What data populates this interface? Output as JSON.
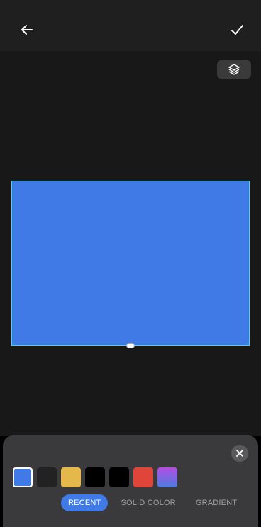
{
  "toolbar": {
    "back_icon": "arrow-left-icon",
    "confirm_icon": "checkmark-icon"
  },
  "canvas": {
    "layers_icon": "layers-icon",
    "selected_fill_color": "#3f7ae6",
    "frame_border_color": "#47d6e6"
  },
  "color_panel": {
    "close_icon": "close-icon",
    "swatches": [
      {
        "color": "#3f7ae6",
        "selected": true
      },
      {
        "color": "#222222",
        "selected": false
      },
      {
        "color": "#e4b84a",
        "selected": false
      },
      {
        "color": "#000000",
        "selected": false
      },
      {
        "color": "#000000",
        "selected": false
      },
      {
        "color": "#e0453a",
        "selected": false
      },
      {
        "color": "gradient:#b44de0-#4d7ce0",
        "selected": false
      }
    ],
    "tabs": [
      {
        "label": "RECENT",
        "active": true
      },
      {
        "label": "SOLID COLOR",
        "active": false
      },
      {
        "label": "GRADIENT",
        "active": false
      }
    ]
  }
}
